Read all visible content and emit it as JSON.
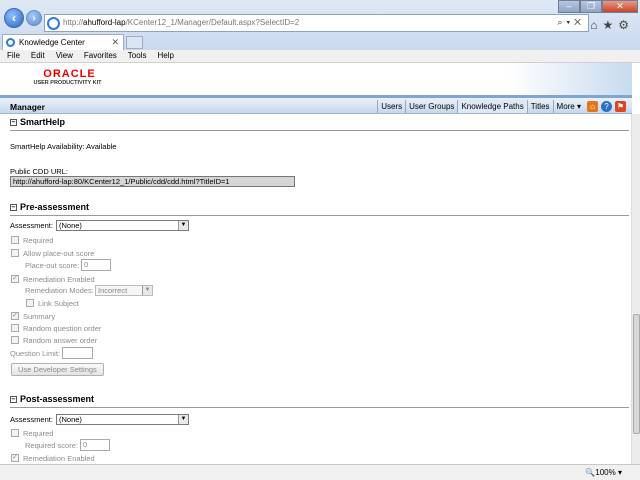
{
  "browser": {
    "url_prefix": "http://",
    "url_host": "ahufford-lap",
    "url_path": "/KCenter12_1/Manager/Default.aspx?SelectID=2",
    "tab_title": "Knowledge Center",
    "menu": [
      "File",
      "Edit",
      "View",
      "Favorites",
      "Tools",
      "Help"
    ],
    "zoom": "100%"
  },
  "header": {
    "logo_brand": "ORACLE",
    "logo_product": "USER PRODUCTIVITY KIT",
    "section_title": "Manager",
    "nav": [
      "Users",
      "User Groups",
      "Knowledge Paths",
      "Titles",
      "More ▾"
    ],
    "active_nav": "Knowledge Paths"
  },
  "smarthelp": {
    "title": "SmartHelp",
    "availability": "SmartHelp Availability: Available",
    "cdd_label": "Public CDD URL:",
    "cdd_url": "http://ahufford-lap:80/KCenter12_1/Public/cdd/cdd.html?TitleID=1"
  },
  "pre_assessment": {
    "title": "Pre-assessment",
    "assessment_label": "Assessment:",
    "assessment_value": "(None)",
    "required": "Required",
    "allow_placeout": "Allow place-out score",
    "placeout_label": "Place-out score:",
    "placeout_value": "0",
    "remediation": "Remediation Enabled",
    "remediation_modes_label": "Remediation Modes:",
    "remediation_modes_value": "Incorrect",
    "link_subject": "Link Subject",
    "summary": "Summary",
    "random_question": "Random question order",
    "random_answer": "Random answer order",
    "question_limit": "Question Limit:",
    "dev_settings": "Use Developer Settings"
  },
  "post_assessment": {
    "title": "Post-assessment",
    "assessment_label": "Assessment:",
    "assessment_value": "(None)",
    "required": "Required",
    "required_score_label": "Required score:",
    "required_score_value": "0",
    "remediation": "Remediation Enabled"
  }
}
